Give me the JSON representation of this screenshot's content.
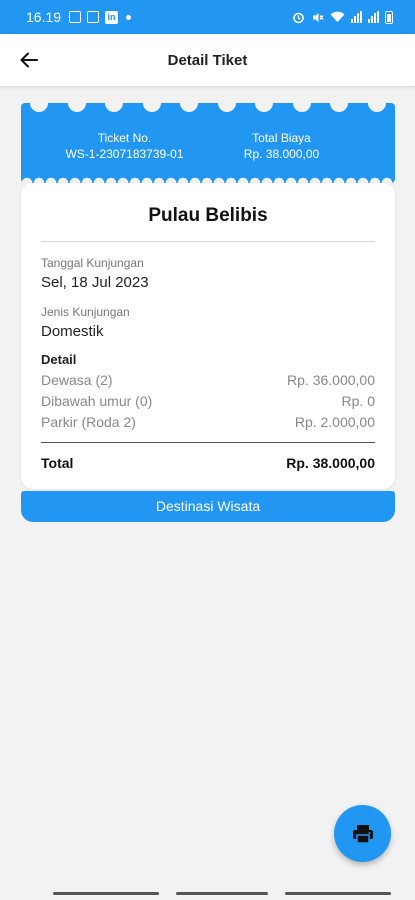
{
  "status_bar": {
    "time": "16.19",
    "left_icons": [
      "image-icon",
      "briefcase-icon",
      "linkedin-icon",
      "dot-icon"
    ],
    "right_icons": [
      "alarm-icon",
      "mute-icon",
      "wifi-icon",
      "signal-icon",
      "signal-icon",
      "battery-icon"
    ]
  },
  "app_bar": {
    "title": "Detail Tiket",
    "back_icon": "arrow-left-icon"
  },
  "ticket": {
    "number_label": "Ticket No.",
    "number_value": "WS-1-2307183739-01",
    "total_label": "Total Biaya",
    "total_value": "Rp. 38.000,00"
  },
  "card": {
    "place": "Pulau Belibis",
    "visit_date_label": "Tanggal Kunjungan",
    "visit_date_value": "Sel, 18 Jul 2023",
    "visit_type_label": "Jenis Kunjungan",
    "visit_type_value": "Domestik",
    "detail_title": "Detail",
    "items": [
      {
        "name": "Dewasa (2)",
        "amount": "Rp. 36.000,00"
      },
      {
        "name": "Dibawah umur (0)",
        "amount": "Rp. 0"
      },
      {
        "name": "Parkir (Roda 2)",
        "amount": "Rp. 2.000,00"
      }
    ],
    "total_label": "Total",
    "total_value": "Rp. 38.000,00"
  },
  "destination_button": "Destinasi Wisata",
  "fab_icon": "print-icon",
  "colors": {
    "primary": "#2196f3",
    "background": "#f2f2f2"
  }
}
